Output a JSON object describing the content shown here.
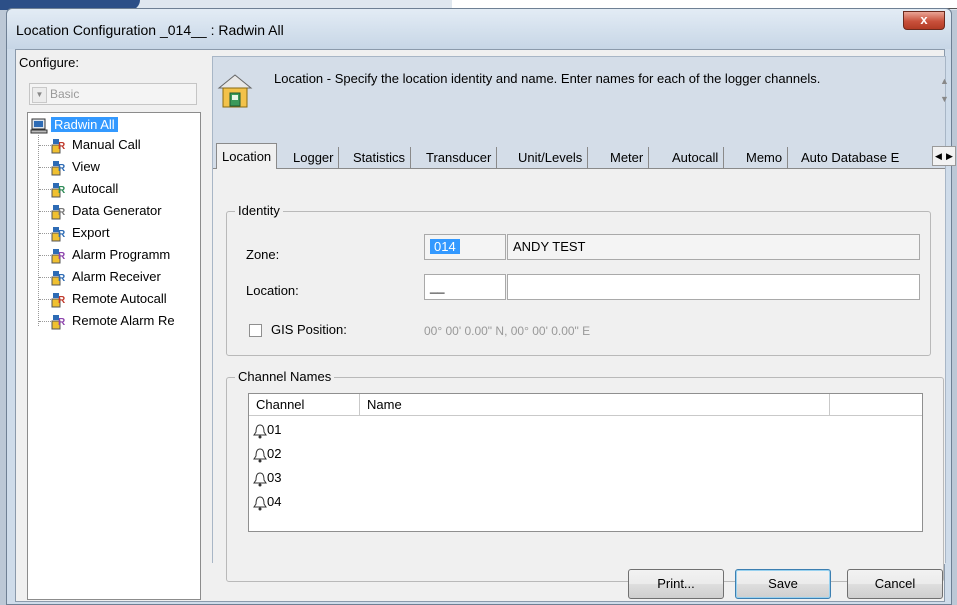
{
  "window": {
    "title": "Location Configuration _014__ : Radwin All",
    "close_label": "x"
  },
  "sidebar": {
    "configure_label": "Configure:",
    "combo_value": "Basic",
    "tree_root": "Radwin All",
    "tree_items": [
      {
        "label": "Manual Call",
        "icon": "manual-call-icon"
      },
      {
        "label": "View",
        "icon": "view-icon"
      },
      {
        "label": "Autocall",
        "icon": "autocall-icon"
      },
      {
        "label": "Data Generator",
        "icon": "data-generator-icon"
      },
      {
        "label": "Export",
        "icon": "export-icon"
      },
      {
        "label": "Alarm Programm",
        "icon": "alarm-programming-icon"
      },
      {
        "label": "Alarm Receiver",
        "icon": "alarm-receiver-icon"
      },
      {
        "label": "Remote Autocall",
        "icon": "remote-autocall-icon"
      },
      {
        "label": "Remote Alarm Re",
        "icon": "remote-alarm-icon"
      }
    ]
  },
  "header": {
    "description": "Location - Specify the location identity and name. Enter names for each of the logger channels."
  },
  "tabs": [
    "Location",
    "Logger",
    "Statistics",
    "Transducer",
    "Unit/Levels",
    "Meter",
    "Autocall",
    "Memo",
    "Auto Database E"
  ],
  "identity": {
    "group_title": "Identity",
    "zone_label": "Zone:",
    "zone_code": "014",
    "zone_name": "ANDY TEST",
    "location_label": "Location:",
    "location_code": "__",
    "location_name": "",
    "gis_label": "GIS Position:",
    "gis_value": "00° 00' 0.00\" N, 00° 00' 0.00\" E",
    "gis_checked": false
  },
  "channels": {
    "group_title": "Channel Names",
    "columns": [
      "Channel",
      "Name"
    ],
    "rows": [
      {
        "channel": "01",
        "name": ""
      },
      {
        "channel": "02",
        "name": ""
      },
      {
        "channel": "03",
        "name": ""
      },
      {
        "channel": "04",
        "name": ""
      }
    ]
  },
  "buttons": {
    "print": "Print...",
    "save": "Save",
    "cancel": "Cancel"
  }
}
